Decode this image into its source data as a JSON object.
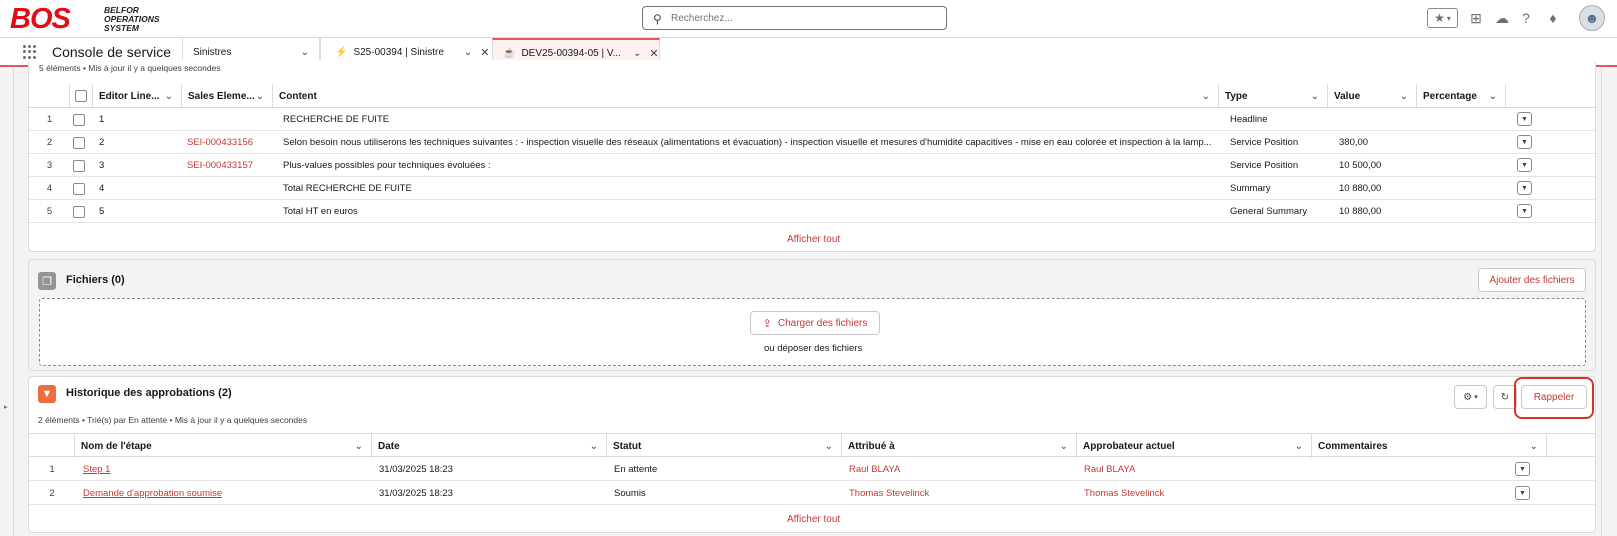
{
  "app": {
    "logo_mark": "BOS",
    "logo_line1": "BELFOR",
    "logo_line2": "OPERATIONS",
    "logo_line3": "SYSTEM",
    "search_placeholder": "Recherchez...",
    "name": "Console de service"
  },
  "nav_tabs": [
    {
      "label": "Sinistres",
      "icon": "chevron-down-icon"
    },
    {
      "label": "S25-00394 | Sinistre",
      "icon": "bolt-icon"
    },
    {
      "label": "DEV25-00394-05 | V...",
      "icon": "quote-icon"
    }
  ],
  "lines": {
    "meta": "5 éléments • Mis à jour il y a quelques secondes",
    "columns": [
      "Editor Line...",
      "Sales Eleme...",
      "Content",
      "Type",
      "Value",
      "Percentage"
    ],
    "rows": [
      {
        "n": "1",
        "line": "1",
        "sales": "",
        "content": "RECHERCHE DE FUITE",
        "type": "Headline",
        "value": ""
      },
      {
        "n": "2",
        "line": "2",
        "sales": "SEI-000433156",
        "content": "Selon besoin nous utiliserons les techniques suivantes : - inspection visuelle des réseaux (alimentations et évacuation) - inspection visuelle et mesures d'humidité capacitives - mise en eau colorée et inspection à la lamp...",
        "type": "Service Position",
        "value": "380,00"
      },
      {
        "n": "3",
        "line": "3",
        "sales": "SEI-000433157",
        "content": "Plus-values possibles pour techniques évoluées :",
        "type": "Service Position",
        "value": "10 500,00"
      },
      {
        "n": "4",
        "line": "4",
        "sales": "",
        "content": "Total RECHERCHE DE FUITE",
        "type": "Summary",
        "value": "10 880,00"
      },
      {
        "n": "5",
        "line": "5",
        "sales": "",
        "content": "Total HT en euros",
        "type": "General Summary",
        "value": "10 880,00"
      }
    ],
    "show_all": "Afficher tout"
  },
  "files": {
    "title": "Fichiers (0)",
    "add_button": "Ajouter des fichiers",
    "upload_button": "Charger des fichiers",
    "drop_text": "ou déposer des fichiers"
  },
  "approvals": {
    "title": "Historique des approbations (2)",
    "meta": "2 éléments • Trié(s) par En attente • Mis à jour il y a quelques secondes",
    "recall_button": "Rappeler",
    "columns": [
      "Nom de l'étape",
      "Date",
      "Statut",
      "Attribué à",
      "Approbateur actuel",
      "Commentaires"
    ],
    "rows": [
      {
        "n": "1",
        "step": "Step 1",
        "date": "31/03/2025 18:23",
        "status": "En attente",
        "assigned": "Raul BLAYA",
        "approver": "Raul BLAYA",
        "comments": ""
      },
      {
        "n": "2",
        "step": "Demande d'approbation soumise",
        "date": "31/03/2025 18:23",
        "status": "Soumis",
        "assigned": "Thomas Stevelinck",
        "approver": "Thomas Stevelinck",
        "comments": ""
      }
    ],
    "show_all": "Afficher tout"
  },
  "colors": {
    "accent": "#c23934",
    "highlight": "#e3565a",
    "brand": "#e20b17"
  }
}
